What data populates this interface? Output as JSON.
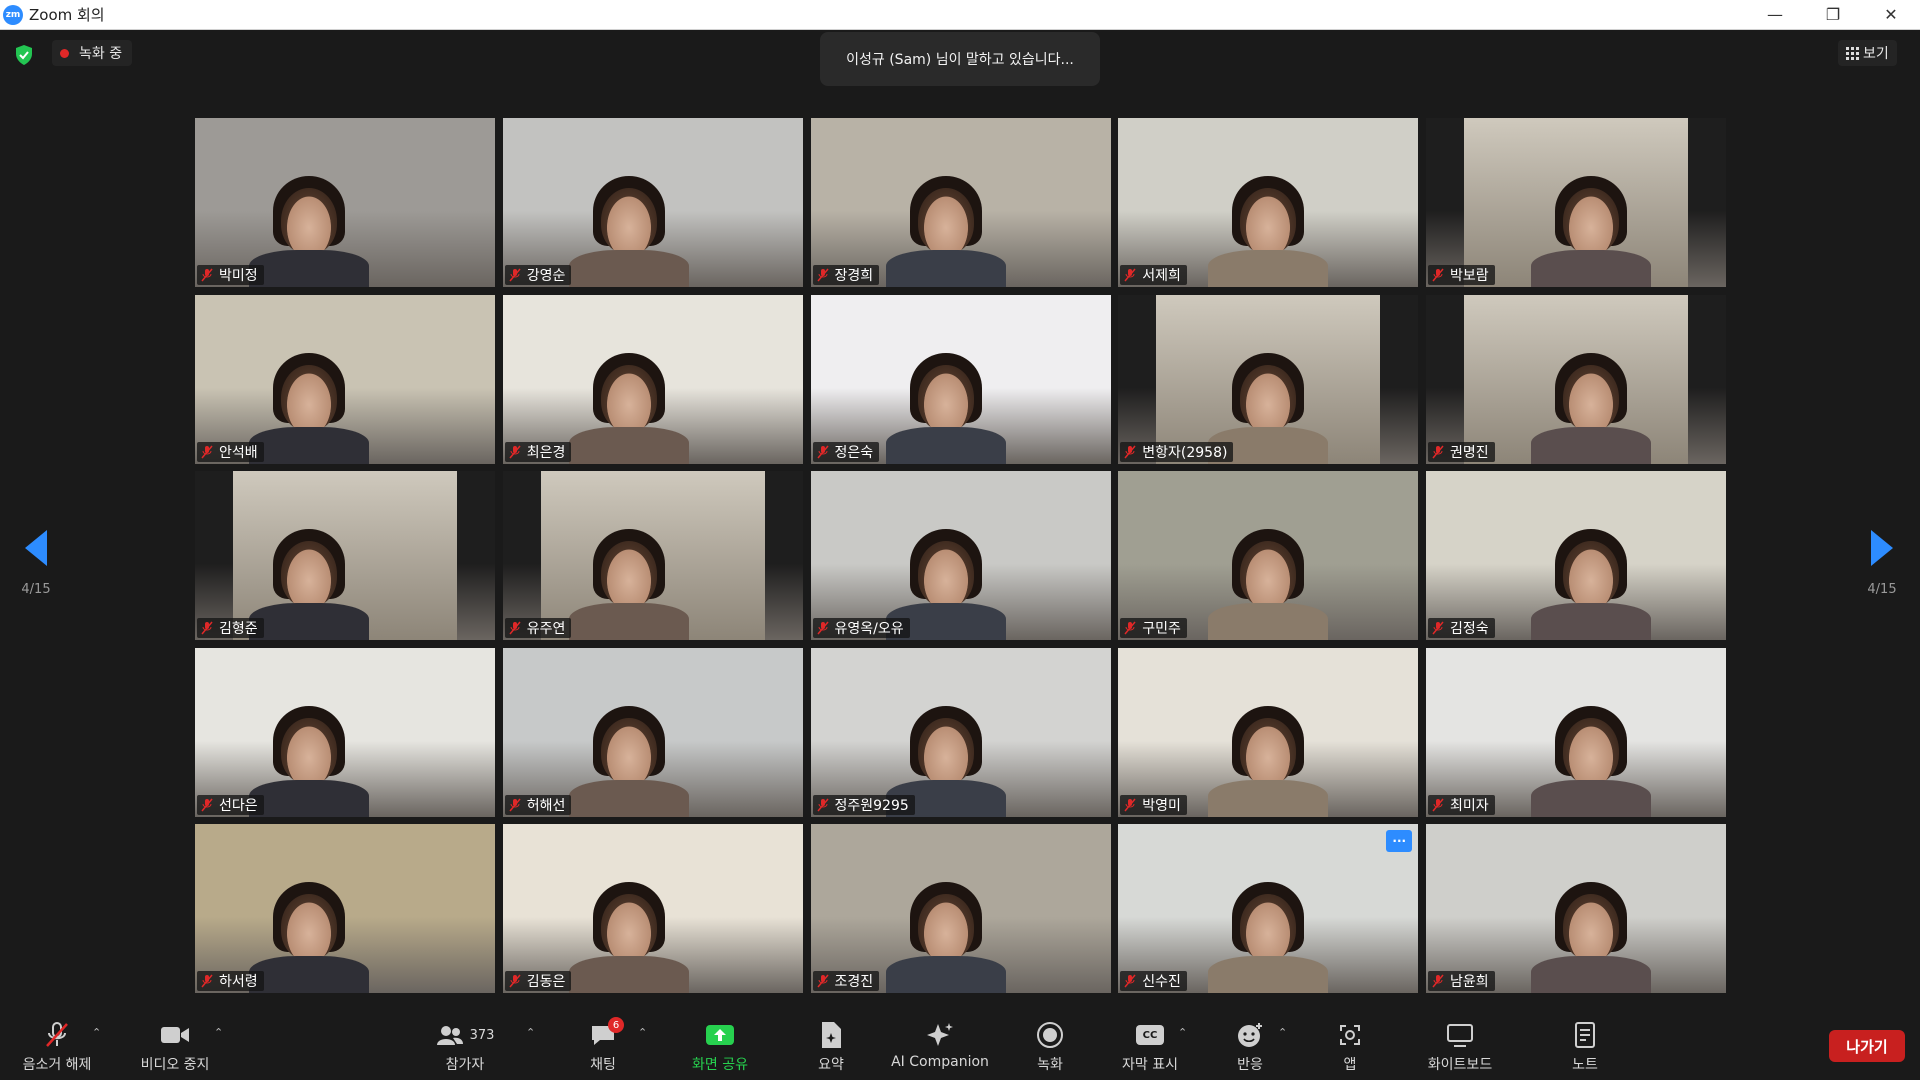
{
  "window": {
    "title": "Zoom 회의",
    "logo_text": "zm"
  },
  "meeting": {
    "recording_label": "녹화 중",
    "speaker_banner": "이성규 (Sam) 님이 말하고 있습니다...",
    "view_label": "보기"
  },
  "pagination": {
    "left": "4/15",
    "right": "4/15"
  },
  "participants": [
    {
      "name": "박미정",
      "bg": "#9d9a96"
    },
    {
      "name": "강영순",
      "bg": "#c2c2c0"
    },
    {
      "name": "장경희",
      "bg": "#b8b2a6"
    },
    {
      "name": "서제희",
      "bg": "#d0cfc7"
    },
    {
      "name": "박보람",
      "bg": "#1e1e1e"
    },
    {
      "name": "안석배",
      "bg": "#c9c3b3"
    },
    {
      "name": "최은경",
      "bg": "#e7e4dc"
    },
    {
      "name": "정은숙",
      "bg": "#efeef0"
    },
    {
      "name": "변항자(2958)",
      "bg": "#1e1e1e"
    },
    {
      "name": "권명진",
      "bg": "#1e1e1e"
    },
    {
      "name": "김형준",
      "bg": "#1e1e1e"
    },
    {
      "name": "유주연",
      "bg": "#1e1e1e"
    },
    {
      "name": "유영옥/오유",
      "bg": "#c9c9c6"
    },
    {
      "name": "구민주",
      "bg": "#a09f92"
    },
    {
      "name": "김정숙",
      "bg": "#d6d3c8"
    },
    {
      "name": "선다은",
      "bg": "#e6e5e0"
    },
    {
      "name": "허해선",
      "bg": "#c7c9c9"
    },
    {
      "name": "정주원9295",
      "bg": "#d3d3d1"
    },
    {
      "name": "박영미",
      "bg": "#e5e1d8"
    },
    {
      "name": "최미자",
      "bg": "#e4e4e2"
    },
    {
      "name": "하서령",
      "bg": "#b8aa8a"
    },
    {
      "name": "김동은",
      "bg": "#e8e2d6"
    },
    {
      "name": "조경진",
      "bg": "#ada79b"
    },
    {
      "name": "신수진",
      "bg": "#d7d9d6"
    },
    {
      "name": "남윤희",
      "bg": "#cfcfcb"
    }
  ],
  "more_button": "···",
  "toolbar": {
    "unmute": "음소거 해제",
    "stop_video": "비디오 중지",
    "participants": "참가자",
    "participants_count": "373",
    "chat": "채팅",
    "chat_badge": "6",
    "share_screen": "화면 공유",
    "summary": "요약",
    "ai_companion": "AI Companion",
    "record": "녹화",
    "captions": "자막 표시",
    "captions_icon": "CC",
    "reactions": "반응",
    "apps": "앱",
    "whiteboard": "화이트보드",
    "notes": "노트",
    "leave": "나가기"
  },
  "colors": {
    "accent": "#2d8cff",
    "recording": "#e02828",
    "leave": "#c8201f",
    "share": "#27d14f"
  }
}
